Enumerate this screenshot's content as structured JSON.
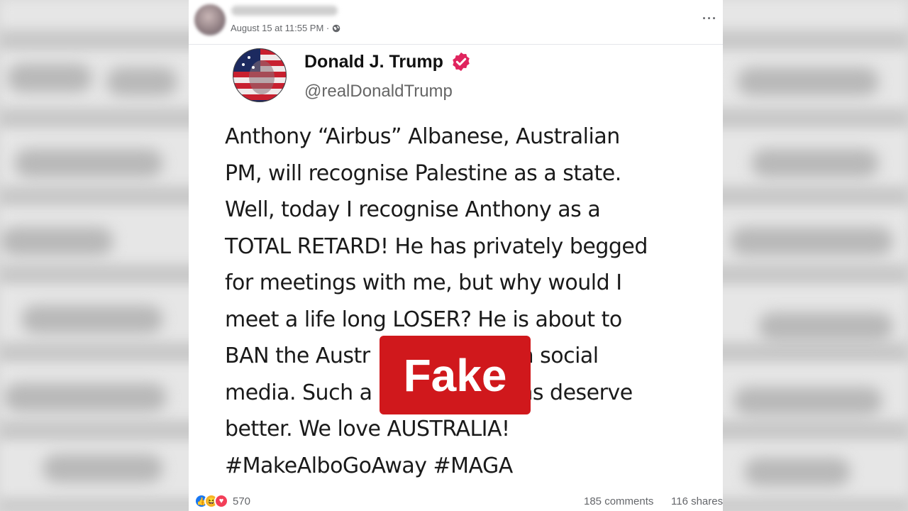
{
  "post": {
    "date": "August 15 at 11:55 PM ·",
    "more_icon": "more-horizontal-icon",
    "privacy_icon": "globe-icon"
  },
  "tweet": {
    "name": "Donald J. Trump",
    "handle": "@realDonaldTrump",
    "verified_icon": "verified-badge-icon",
    "verified_color": "#e0245e",
    "lines": [
      "Anthony “Airbus” Albanese, Australian",
      "PM, will recognise Palestine as a state.",
      "Well, today I recognise Anthony as a",
      "TOTAL RETARD! He has privately begged",
      "for meetings with me, but why would I",
      "meet a life long LOSER? He is about to",
      "BAN the Austr                  from social",
      "media. Such a                ralians deserve",
      "better. We love AUSTRALIA!",
      "#MakeAlboGoAway #MAGA"
    ]
  },
  "overlay": {
    "label": "Fake",
    "color": "#d0181c"
  },
  "footer": {
    "reaction_icons": [
      "like-icon",
      "haha-icon",
      "love-icon"
    ],
    "reaction_count": "570",
    "comments": "185 comments",
    "shares": "116 shares"
  }
}
